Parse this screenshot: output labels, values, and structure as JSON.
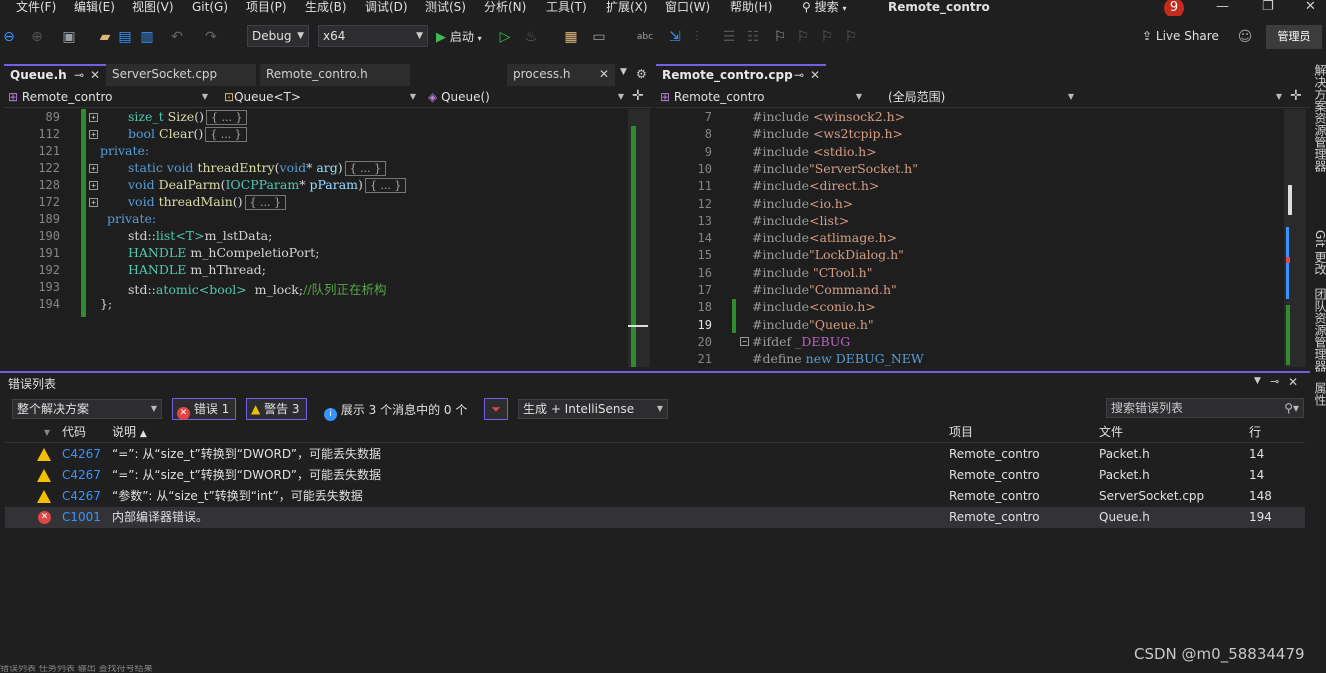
{
  "menu": {
    "items": [
      "文件(F)",
      "编辑(E)",
      "视图(V)",
      "Git(G)",
      "项目(P)",
      "生成(B)",
      "调试(D)",
      "测试(S)",
      "分析(N)",
      "工具(T)",
      "扩展(X)",
      "窗口(W)",
      "帮助(H)"
    ],
    "search": "搜索",
    "app_title": "Remote_contro",
    "notification_count": "9"
  },
  "toolbar": {
    "config": "Debug",
    "platform": "x64",
    "start_label": "启动",
    "live_share": "Live Share",
    "admin": "管理员"
  },
  "left_editor": {
    "tabs": [
      {
        "label": "Queue.h",
        "active": true
      },
      {
        "label": "ServerSocket.cpp",
        "active": false
      },
      {
        "label": "Remote_contro.h",
        "active": false
      },
      {
        "label": "process.h",
        "active": false
      }
    ],
    "nav": {
      "project": "Remote_contro",
      "scope": "Queue<T>",
      "member": "Queue()"
    },
    "line_numbers": [
      "89",
      "112",
      "121",
      "122",
      "128",
      "172",
      "189",
      "190",
      "191",
      "192",
      "193",
      "194"
    ],
    "collapsed_marker": "{ ... }",
    "code": {
      "l89": {
        "type": "size_t",
        "name": "Size",
        "sig": "()"
      },
      "l112": {
        "kw": "bool",
        "name": "Clear",
        "sig": "()"
      },
      "l121": "private:",
      "l122": {
        "kw1": "static",
        "kw2": "void",
        "name": "threadEntry",
        "open": "(",
        "ptype": "void",
        "star": "* ",
        "param": "arg",
        "close": ")"
      },
      "l128": {
        "kw": "void",
        "name": "DealParm",
        "open": "(",
        "ptype": "IOCPParam",
        "star": "* ",
        "param": "pParam",
        "close": ")"
      },
      "l172": {
        "kw": "void",
        "name": "threadMain",
        "sig": "()"
      },
      "l189": "private:",
      "l190": {
        "ns": "std::",
        "type": "list",
        "targ": "<T>",
        "name": "m_lstData",
        "end": ";"
      },
      "l191": {
        "type": "HANDLE",
        "name": "m_hCompeletioPort",
        "end": ";"
      },
      "l192": {
        "type": "HANDLE",
        "name": "m_hThread",
        "end": ";"
      },
      "l193": {
        "ns": "std::",
        "type": "atomic",
        "targ": "<bool>",
        "name": "  m_lock",
        "end": ";",
        "comment": "//队列正在析构"
      },
      "l194": "};"
    }
  },
  "right_editor": {
    "tab": "Remote_contro.cpp",
    "nav": {
      "project": "Remote_contro",
      "scope": "(全局范围)"
    },
    "line_numbers": [
      "7",
      "8",
      "9",
      "10",
      "11",
      "12",
      "13",
      "14",
      "15",
      "16",
      "17",
      "18",
      "19",
      "20",
      "21"
    ],
    "lines": [
      {
        "d": "#include ",
        "f": "<winsock2.h>"
      },
      {
        "d": "#include ",
        "f": "<ws2tcpip.h>"
      },
      {
        "d": "#include ",
        "f": "<stdio.h>"
      },
      {
        "d": "#include",
        "f": "\"ServerSocket.h\""
      },
      {
        "d": "#include",
        "f": "<direct.h>"
      },
      {
        "d": "#include",
        "f": "<io.h>"
      },
      {
        "d": "#include",
        "f": "<list>"
      },
      {
        "d": "#include",
        "f": "<atlimage.h>"
      },
      {
        "d": "#include",
        "f": "\"LockDialog.h\""
      },
      {
        "d": "#include ",
        "f": "\"CTool.h\""
      },
      {
        "d": "#include",
        "f": "\"Command.h\""
      },
      {
        "d": "#include",
        "f": "<conio.h>"
      },
      {
        "d": "#include",
        "f": "\"Queue.h\""
      },
      {
        "d": "#ifdef ",
        "f": "_DEBUG"
      },
      {
        "d": "#define ",
        "f": "new DEBUG_NEW"
      }
    ]
  },
  "error_list": {
    "title": "错误列表",
    "scope": "整个解决方案",
    "errors_btn": "错误 1",
    "warnings_btn": "警告 3",
    "messages_text": "展示 3 个消息中的 0 个",
    "source": "生成 + IntelliSense",
    "search_placeholder": "搜索错误列表",
    "headers": {
      "code": "代码",
      "desc": "说明",
      "project": "项目",
      "file": "文件",
      "line": "行"
    },
    "rows": [
      {
        "severity": "warning",
        "code": "C4267",
        "desc": "“=”: 从“size_t”转换到“DWORD”，可能丢失数据",
        "project": "Remote_contro",
        "file": "Packet.h",
        "line": "14"
      },
      {
        "severity": "warning",
        "code": "C4267",
        "desc": "“=”: 从“size_t”转换到“DWORD”，可能丢失数据",
        "project": "Remote_contro",
        "file": "Packet.h",
        "line": "14"
      },
      {
        "severity": "warning",
        "code": "C4267",
        "desc": "“参数”: 从“size_t”转换到“int”，可能丢失数据",
        "project": "Remote_contro",
        "file": "ServerSocket.cpp",
        "line": "148"
      },
      {
        "severity": "error",
        "code": "C1001",
        "desc": "内部编译器错误。",
        "project": "Remote_contro",
        "file": "Queue.h",
        "line": "194"
      }
    ]
  },
  "right_rail": {
    "items": [
      "解决方案资源管理器",
      "Git 更改",
      "团队资源管理器",
      "属性"
    ]
  },
  "status": "错误列表    任务列表    输出    查找符号结果",
  "watermark": "CSDN @m0_58834479",
  "colors": {
    "accent": "#7160e8",
    "keyword": "#569cd6",
    "type": "#4ec9b0",
    "comment": "#57a64a",
    "string": "#d69d85",
    "error": "#e04646",
    "warning": "#f0c000"
  }
}
